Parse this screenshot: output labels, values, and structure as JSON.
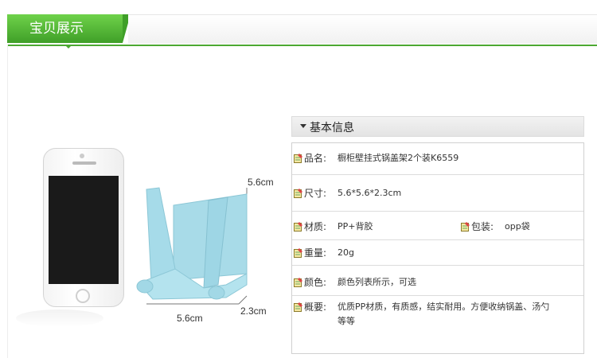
{
  "header": {
    "tab_label": "宝贝展示"
  },
  "product_image": {
    "dim_height": "5.6cm",
    "dim_width": "5.6cm",
    "dim_depth": "2.3cm",
    "holder_color": "#9fd8e6"
  },
  "info": {
    "title": "基本信息",
    "rows": [
      {
        "label": "品名:",
        "value": "橱柜壁挂式锅盖架2个装K6559"
      },
      {
        "label": "尺寸:",
        "value": "5.6*5.6*2.3cm"
      },
      {
        "label": "材质:",
        "value": "PP+背胶",
        "label2": "包装:",
        "value2": "opp袋"
      },
      {
        "label": "重量:",
        "value": "20g"
      },
      {
        "label": "颜色:",
        "value": "颜色列表所示，可选"
      },
      {
        "label": "概要:",
        "value": "优质PP材质，有质感，结实耐用。方便收纳锅盖、汤勺",
        "value_line2": "等等"
      }
    ]
  }
}
